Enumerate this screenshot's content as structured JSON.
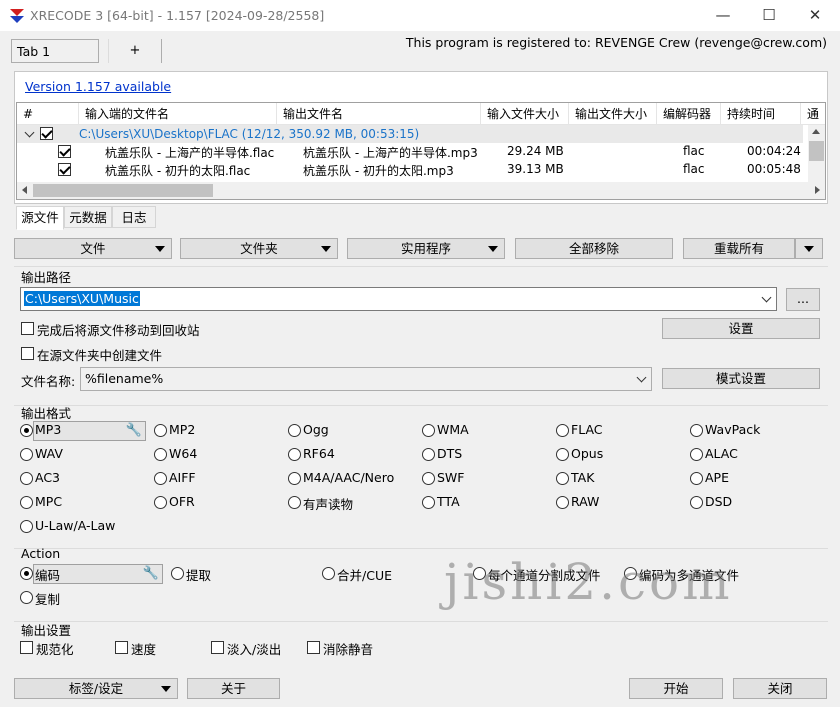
{
  "window": {
    "title": "XRECODE 3 [64-bit] - 1.157 [2024-09-28/2558]",
    "minimize": "—",
    "maximize": "☐",
    "close": "✕"
  },
  "tabs": {
    "tab1": "Tab 1",
    "add": "+"
  },
  "registration": "This program is registered to: REVENGE Crew (revenge@crew.com)",
  "version_link": "Version 1.157 available",
  "table": {
    "columns": [
      "#",
      "输入端的文件名",
      "输出文件名",
      "输入文件大小",
      "输出文件大小",
      "编解码器",
      "持续时间",
      "通"
    ],
    "group": "C:\\Users\\XU\\Desktop\\FLAC (12/12, 350.92 MB, 00:53:15)",
    "rows": [
      {
        "input": "杭盖乐队 - 上海产的半导体.flac",
        "output": "杭盖乐队 - 上海产的半导体.mp3",
        "size": "29.24 MB",
        "codec": "flac",
        "duration": "00:04:24"
      },
      {
        "input": "杭盖乐队 - 初升的太阳.flac",
        "output": "杭盖乐队 - 初升的太阳.mp3",
        "size": "39.13 MB",
        "codec": "flac",
        "duration": "00:05:48"
      }
    ]
  },
  "subtabs": [
    "源文件",
    "元数据",
    "日志"
  ],
  "toolbar": {
    "file": "文件",
    "folder": "文件夹",
    "utility": "实用程序",
    "remove_all": "全部移除",
    "reload_all": "重载所有"
  },
  "output_path": {
    "title": "输出路径",
    "value": "C:\\Users\\XU\\Music",
    "browse": "...",
    "move_to_recycle": "完成后将源文件移动到回收站",
    "create_in_source": "在源文件夹中创建文件",
    "settings": "设置",
    "filename_label": "文件名称:",
    "filename_value": "%filename%",
    "pattern_settings": "模式设置"
  },
  "output_format": {
    "title": "输出格式",
    "selected": "MP3",
    "options": [
      [
        "MP3",
        "MP2",
        "Ogg",
        "WMA",
        "FLAC",
        "WavPack"
      ],
      [
        "WAV",
        "W64",
        "RF64",
        "DTS",
        "Opus",
        "ALAC"
      ],
      [
        "AC3",
        "AIFF",
        "M4A/AAC/Nero",
        "SWF",
        "TAK",
        "APE"
      ],
      [
        "MPC",
        "OFR",
        "有声读物",
        "TTA",
        "RAW",
        "DSD"
      ],
      [
        "U-Law/A-Law"
      ]
    ]
  },
  "action": {
    "title": "Action",
    "options": [
      "编码",
      "提取",
      "合并/CUE",
      "每个通道分割成文件",
      "编码为多通道文件",
      "复制"
    ],
    "selected": "编码"
  },
  "output_settings": {
    "title": "输出设置",
    "options": [
      "规范化",
      "速度",
      "淡入/淡出",
      "消除静音"
    ]
  },
  "bottom": {
    "tags_settings": "标签/设定",
    "about": "关于",
    "start": "开始",
    "close": "关闭"
  },
  "watermark": "jishi2.com",
  "colors": {
    "link": "#0033cc",
    "group_text": "#1a73c9",
    "selection": "#0078d7",
    "logo_red": "#d21f1f",
    "logo_blue": "#1f3fbf"
  }
}
